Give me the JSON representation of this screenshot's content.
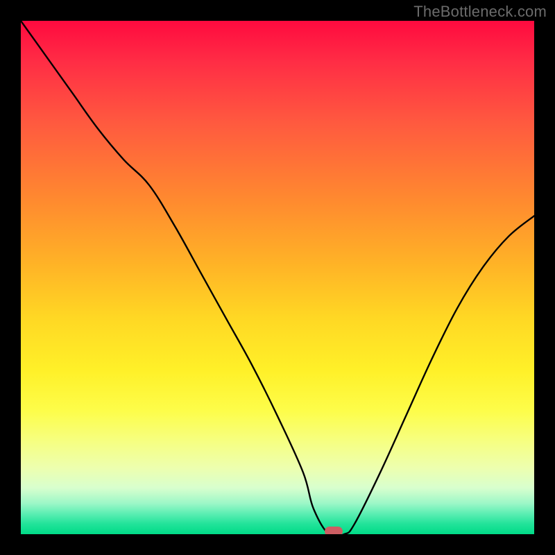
{
  "watermark": "TheBottleneck.com",
  "colors": {
    "frame": "#000000",
    "curve": "#000000",
    "marker": "#cd5e63"
  },
  "chart_data": {
    "type": "line",
    "title": "",
    "xlabel": "",
    "ylabel": "",
    "xlim": [
      0,
      100
    ],
    "ylim": [
      0,
      100
    ],
    "x": [
      0,
      5,
      10,
      15,
      20,
      25,
      30,
      35,
      40,
      45,
      50,
      55,
      57,
      60,
      63,
      65,
      70,
      75,
      80,
      85,
      90,
      95,
      100
    ],
    "values": [
      100,
      93,
      86,
      79,
      73,
      68,
      60,
      51,
      42,
      33,
      23,
      12,
      5,
      0,
      0,
      2,
      12,
      23,
      34,
      44,
      52,
      58,
      62
    ],
    "minimum_region": {
      "x_start": 58,
      "x_end": 64,
      "y": 0
    },
    "background": "vertical rainbow gradient red→orange→yellow→green"
  }
}
